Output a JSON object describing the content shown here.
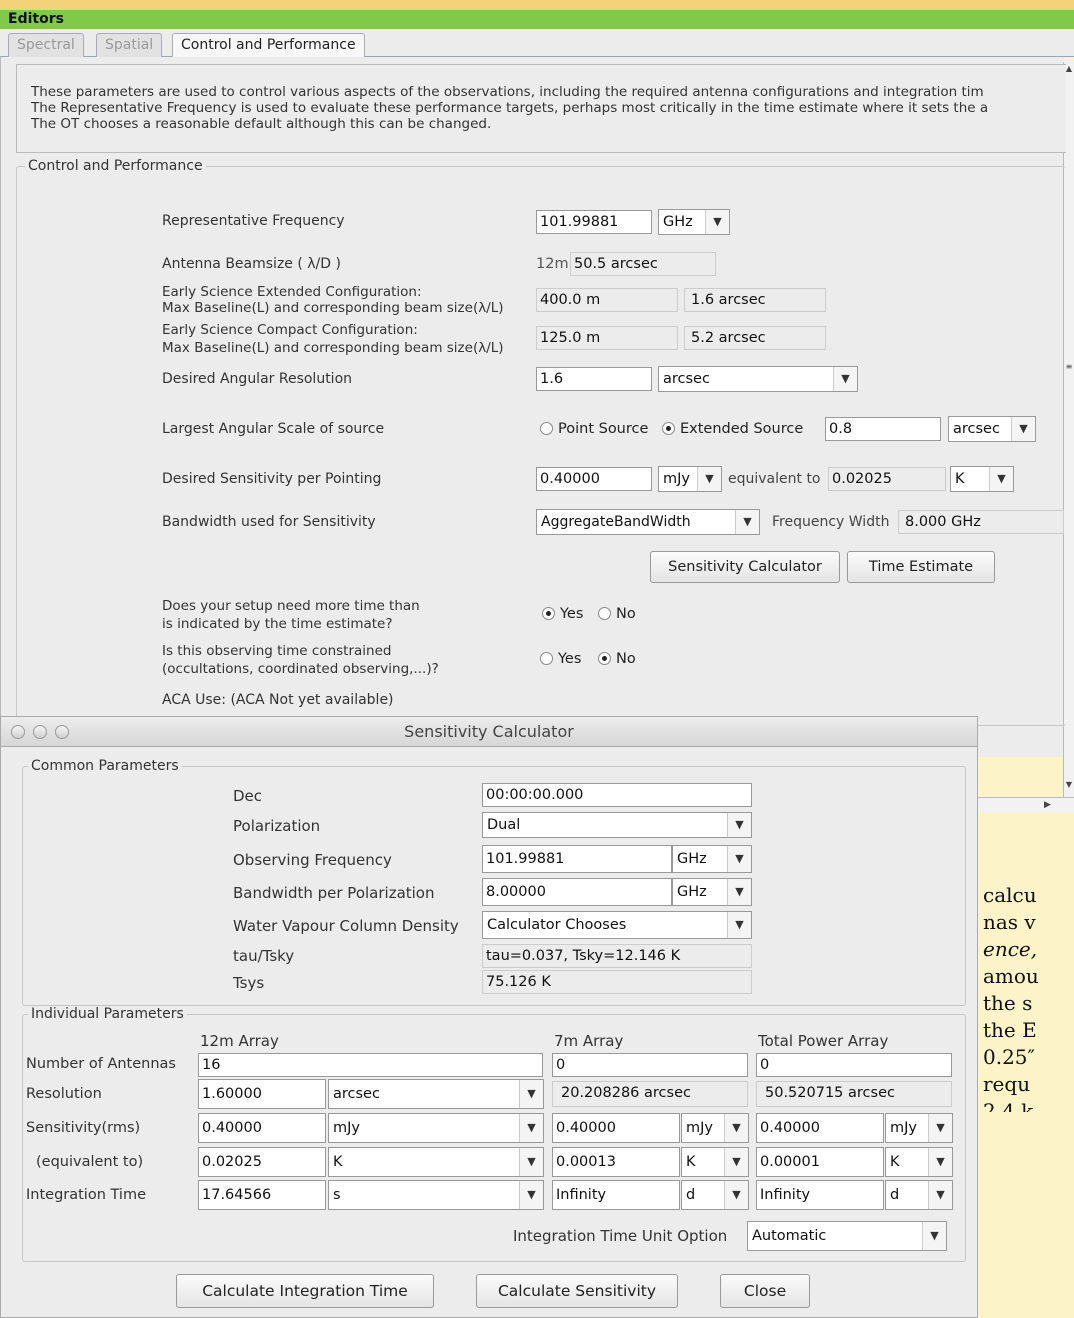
{
  "editors_title": "Editors",
  "tabs": [
    "Spectral",
    "Spatial",
    "Control and Performance"
  ],
  "intro": [
    "These parameters are used to control various aspects of the observations, including the required antenna configurations and integration tim",
    "The Representative Frequency is used to evaluate these performance targets, perhaps most critically in the time estimate where it sets the a",
    "The OT chooses a reasonable default although this can be changed."
  ],
  "control": {
    "group_label": "Control and Performance",
    "rep_freq": {
      "label": "Representative Frequency",
      "value": "101.99881",
      "unit": "GHz"
    },
    "beamsize": {
      "label": "Antenna Beamsize ( λ/D )",
      "prefix": "12m",
      "value": "50.5 arcsec"
    },
    "extended": {
      "label1": "Early Science Extended Configuration:",
      "label2": "Max Baseline(L) and corresponding beam size(λ/L)",
      "baseline": "400.0 m",
      "beam": "1.6 arcsec"
    },
    "compact": {
      "label1": "Early Science Compact Configuration:",
      "label2": "Max Baseline(L) and corresponding beam size(λ/L)",
      "baseline": "125.0 m",
      "beam": "5.2 arcsec"
    },
    "angres": {
      "label": "Desired Angular Resolution",
      "value": "1.6",
      "unit": "arcsec"
    },
    "las": {
      "label": "Largest Angular Scale of source",
      "opt_point": "Point Source",
      "opt_extended": "Extended Source",
      "value": "0.8",
      "unit": "arcsec"
    },
    "sens": {
      "label": "Desired Sensitivity per Pointing",
      "value": "0.40000",
      "unit": "mJy",
      "equiv_label": "equivalent to",
      "equiv_value": "0.02025",
      "equiv_unit": "K"
    },
    "bandwidth": {
      "label": "Bandwidth used for Sensitivity",
      "value": "AggregateBandWidth",
      "fw_label": "Frequency Width",
      "fw_value": "8.000 GHz"
    },
    "buttons": {
      "sens_calc": "Sensitivity Calculator",
      "time_est": "Time Estimate"
    },
    "more_time": {
      "label1": "Does your setup need more time than",
      "label2": "is indicated by the time estimate?",
      "yes": "Yes",
      "no": "No"
    },
    "constrained": {
      "label1": "Is this observing time constrained",
      "label2": "(occultations, coordinated observing,...)?",
      "yes": "Yes",
      "no": "No"
    },
    "aca": "ACA Use: (ACA Not yet available)"
  },
  "calc": {
    "title": "Sensitivity Calculator",
    "common_label": "Common Parameters",
    "dec": {
      "label": "Dec",
      "value": "00:00:00.000"
    },
    "pol": {
      "label": "Polarization",
      "value": "Dual"
    },
    "obs_freq": {
      "label": "Observing Frequency",
      "value": "101.99881",
      "unit": "GHz"
    },
    "bw_pol": {
      "label": "Bandwidth per Polarization",
      "value": "8.00000",
      "unit": "GHz"
    },
    "wv": {
      "label": "Water Vapour Column Density",
      "value": "Calculator Chooses"
    },
    "tau": {
      "label": "tau/Tsky",
      "value": "tau=0.037, Tsky=12.146 K"
    },
    "tsys": {
      "label": "Tsys",
      "value": "75.126 K"
    },
    "indiv_label": "Individual Parameters",
    "col_12m": "12m Array",
    "col_7m": "7m Array",
    "col_tp": "Total Power Array",
    "row_labels": {
      "antennas": "Number of Antennas",
      "resolution": "Resolution",
      "sensitivity": "Sensitivity(rms)",
      "equivalent": "(equivalent to)",
      "integration": "Integration Time"
    },
    "a12": {
      "antennas": "16",
      "res": "1.60000",
      "res_unit": "arcsec",
      "sens": "0.40000",
      "sens_unit": "mJy",
      "equiv": "0.02025",
      "equiv_unit": "K",
      "time": "17.64566",
      "time_unit": "s"
    },
    "a7": {
      "antennas": "0",
      "res": "20.208286 arcsec",
      "sens": "0.40000",
      "sens_unit": "mJy",
      "equiv": "0.00013",
      "equiv_unit": "K",
      "time": "Infinity",
      "time_unit": "d"
    },
    "tp": {
      "antennas": "0",
      "res": "50.520715 arcsec",
      "sens": "0.40000",
      "sens_unit": "mJy",
      "equiv": "0.00001",
      "equiv_unit": "K",
      "time": "Infinity",
      "time_unit": "d"
    },
    "unit_option": {
      "label": "Integration Time Unit Option",
      "value": "Automatic"
    },
    "buttons": {
      "calc_time": "Calculate Integration Time",
      "calc_sens": "Calculate Sensitivity",
      "close": "Close"
    }
  },
  "doc_lines": [
    "calcu",
    "nas v",
    "ence,",
    "amou",
    "the s",
    "the E",
    "0.25″",
    "requ",
    "2.4 k"
  ]
}
